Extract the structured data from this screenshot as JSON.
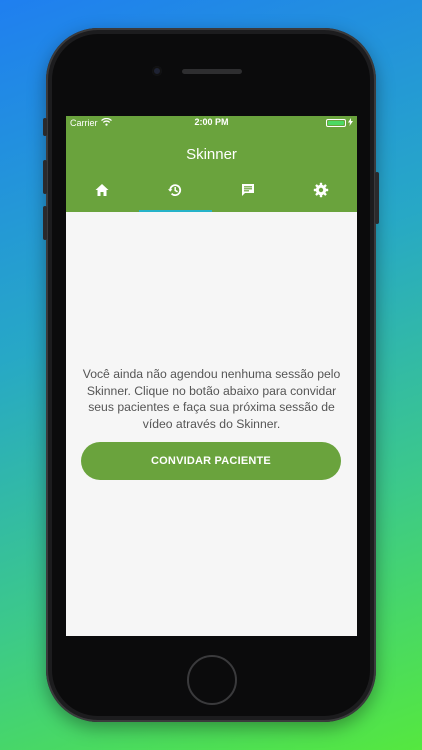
{
  "status_bar": {
    "carrier": "Carrier",
    "time": "2:00 PM"
  },
  "appbar": {
    "title": "Skinner",
    "color": "#6aa33d"
  },
  "tabs": [
    {
      "icon": "home-icon",
      "active": false
    },
    {
      "icon": "history-icon",
      "active": true
    },
    {
      "icon": "chat-icon",
      "active": false
    },
    {
      "icon": "gear-icon",
      "active": false
    }
  ],
  "empty_state": {
    "message": "Você ainda não agendou nenhuma sessão pelo Skinner. Clique no botão abaixo para convidar seus pacientes e faça sua próxima sessão de vídeo através do Skinner.",
    "button_label": "CONVIDAR PACIENTE"
  },
  "colors": {
    "accent": "#6aa33d",
    "tab_indicator": "#26b3c9"
  }
}
